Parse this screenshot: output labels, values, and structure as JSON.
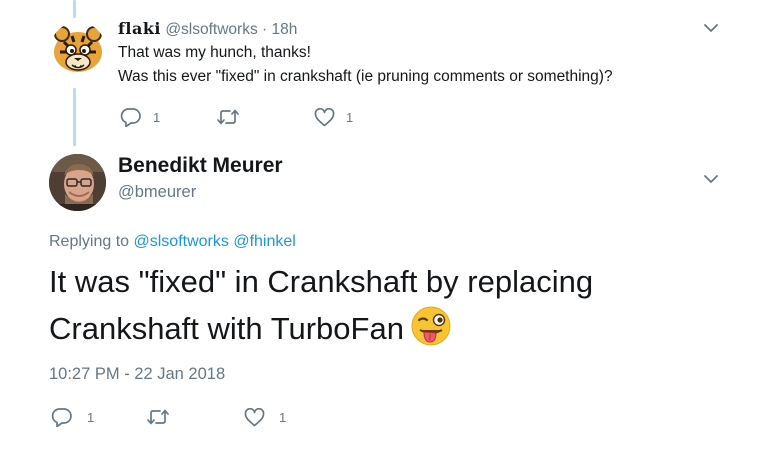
{
  "reply_tweet": {
    "display_name": "flaki",
    "handle": "@slsoftworks",
    "separator": "·",
    "age": "18h",
    "lines": [
      "That was my hunch, thanks!",
      "Was this ever \"fixed\" in crankshaft (ie pruning comments or something)?"
    ],
    "reply_count": "1",
    "retweet_count": "",
    "like_count": "1"
  },
  "main_tweet": {
    "display_name": "Benedikt Meurer",
    "handle": "@bmeurer",
    "replying_prefix": "Replying to",
    "replying_to": [
      "@slsoftworks",
      "@fhinkel"
    ],
    "text_line1": "It was \"fixed\" in Crankshaft by replacing",
    "text_line2": "Crankshaft with TurboFan",
    "emoji_name": "winking-face-with-tongue",
    "timestamp": "10:27 PM - 22 Jan 2018",
    "reply_count": "1",
    "retweet_count": "",
    "like_count": "1"
  },
  "colors": {
    "link": "#1b95e0",
    "secondary_text": "#657786",
    "thread_line": "#b8dcf4"
  }
}
